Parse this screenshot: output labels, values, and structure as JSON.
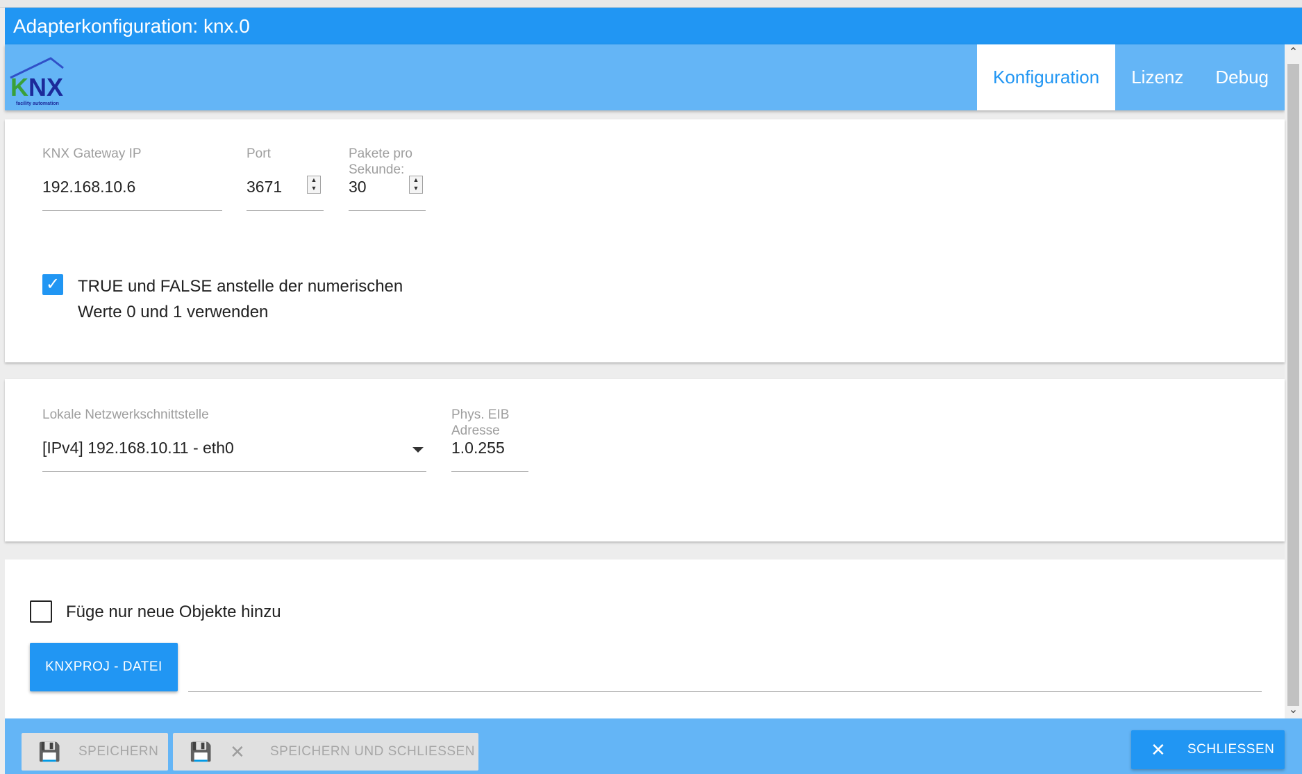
{
  "window": {
    "title": "Adapterkonfiguration: knx.0"
  },
  "logo": {
    "text": "KNX",
    "tagline": "facility automation"
  },
  "tabs": [
    {
      "label": "Konfiguration",
      "active": true
    },
    {
      "label": "Lizenz",
      "active": false
    },
    {
      "label": "Debug",
      "active": false
    }
  ],
  "connection": {
    "gateway_ip": {
      "label": "KNX Gateway IP",
      "value": "192.168.10.6"
    },
    "port": {
      "label": "Port",
      "value": "3671"
    },
    "packets": {
      "label": "Pakete pro Sekunde:",
      "value": "30"
    },
    "boolean_option": {
      "checked": true,
      "line1": "TRUE und FALSE anstelle der numerischen",
      "line2": "Werte 0 und 1 verwenden"
    }
  },
  "network": {
    "interface": {
      "label": "Lokale Netzwerkschnittstelle",
      "value": "[IPv4] 192.168.10.11 - eth0"
    },
    "eib_address": {
      "label": "Phys. EIB Adresse",
      "value": "1.0.255"
    }
  },
  "import": {
    "only_new": {
      "checked": false,
      "label": "Füge nur neue Objekte hinzu"
    },
    "file_button": "KNXPROJ - DATEI"
  },
  "footer": {
    "save": "SPEICHERN",
    "save_close": "SPEICHERN UND SCHLIESSEN",
    "close": "SCHLIESSEN"
  },
  "colors": {
    "primary": "#2196f3",
    "header": "#64b5f6",
    "disabled": "#e0e0e0"
  }
}
